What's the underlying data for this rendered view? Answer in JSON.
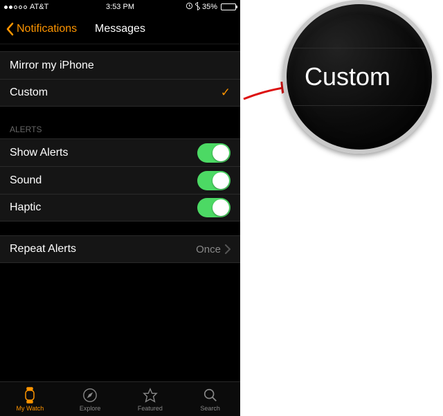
{
  "status": {
    "carrier": "AT&T",
    "time": "3:53 PM",
    "battery_text": "35%"
  },
  "nav": {
    "back_label": "Notifications",
    "title": "Messages"
  },
  "mirror_group": {
    "mirror_label": "Mirror my iPhone",
    "custom_label": "Custom"
  },
  "alerts": {
    "header": "ALERTS",
    "show_alerts": "Show Alerts",
    "sound": "Sound",
    "haptic": "Haptic"
  },
  "repeat": {
    "label": "Repeat Alerts",
    "value": "Once"
  },
  "tabs": {
    "my_watch": "My Watch",
    "explore": "Explore",
    "featured": "Featured",
    "search": "Search"
  },
  "callout": {
    "text": "Custom"
  }
}
